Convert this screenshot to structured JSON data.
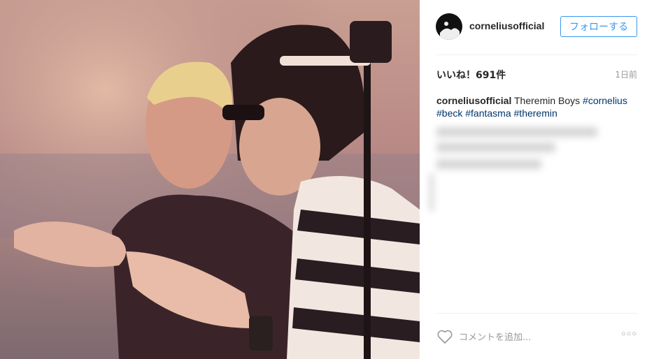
{
  "post": {
    "username": "corneliusofficial",
    "follow_label": "フォローする",
    "likes": "いいね！691件",
    "time": "1日前",
    "caption_user": "corneliusofficial",
    "caption_text": " Theremin Boys ",
    "hashtags": [
      "#cornelius",
      "#beck",
      "#fantasma",
      "#theremin"
    ],
    "comment_placeholder": "コメントを追加...",
    "more_label": "○○○"
  },
  "colors": {
    "link": "#003569",
    "follow": "#3897f0",
    "muted": "#999999"
  },
  "icons": {
    "like": "heart-outline-icon",
    "more": "more-options-icon"
  }
}
